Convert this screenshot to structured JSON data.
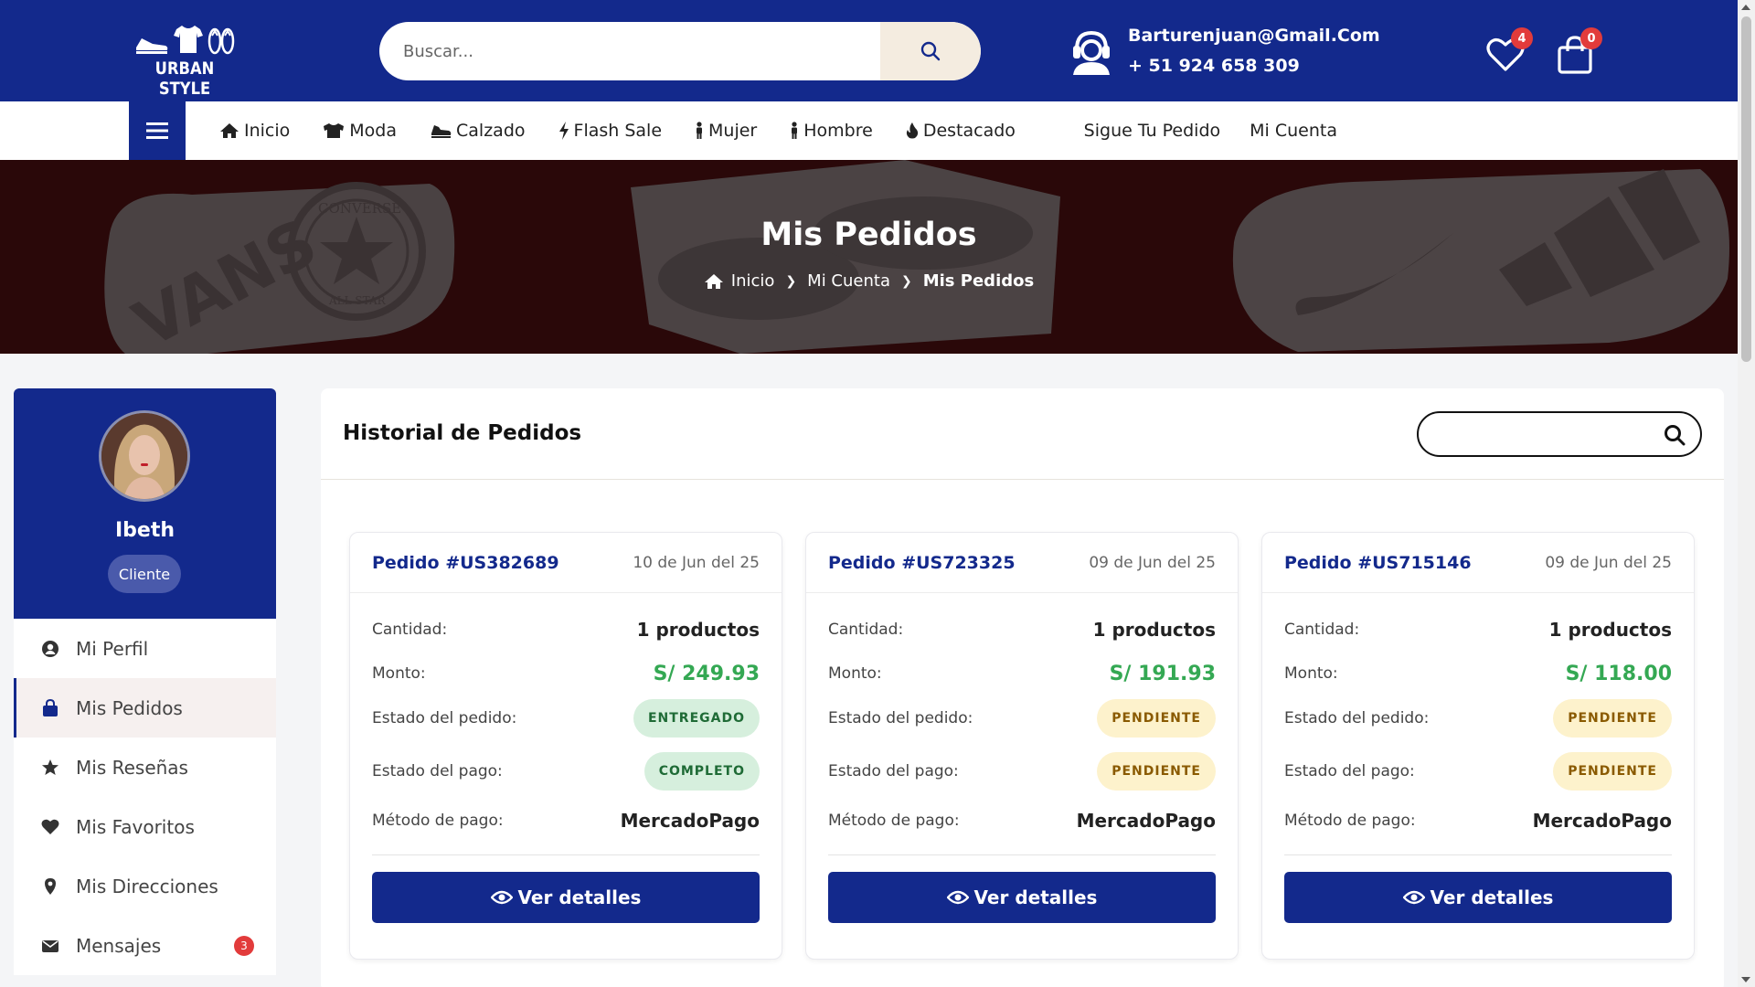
{
  "header": {
    "logo_text": "URBAN STYLE",
    "search_placeholder": "Buscar...",
    "email": "Barturenjuan@Gmail.Com",
    "phone": "+ 51 924 658 309",
    "wishlist_count": "4",
    "cart_count": "0"
  },
  "nav": {
    "items": [
      {
        "label": "Inicio",
        "icon": "home-icon"
      },
      {
        "label": "Moda",
        "icon": "tshirt-icon"
      },
      {
        "label": "Calzado",
        "icon": "shoe-icon"
      },
      {
        "label": "Flash Sale",
        "icon": "bolt-icon"
      },
      {
        "label": "Mujer",
        "icon": "person-icon"
      },
      {
        "label": "Hombre",
        "icon": "person-icon"
      },
      {
        "label": "Destacado",
        "icon": "fire-icon"
      }
    ],
    "right": [
      "Sigue Tu Pedido",
      "Mi Cuenta"
    ]
  },
  "hero": {
    "title": "Mis Pedidos",
    "breadcrumb": [
      "Inicio",
      "Mi Cuenta",
      "Mis Pedidos"
    ],
    "brand_art": [
      "VANS",
      "CONVERSE",
      "ALL STAR"
    ]
  },
  "profile": {
    "name": "Ibeth",
    "role": "Cliente"
  },
  "sidebar": {
    "items": [
      {
        "label": "Mi Perfil",
        "icon": "user-circle-icon",
        "active": false
      },
      {
        "label": "Mis Pedidos",
        "icon": "shopping-bag-icon",
        "active": true
      },
      {
        "label": "Mis Reseñas",
        "icon": "star-icon",
        "active": false
      },
      {
        "label": "Mis Favoritos",
        "icon": "heart-icon",
        "active": false
      },
      {
        "label": "Mis Direcciones",
        "icon": "map-pin-icon",
        "active": false
      },
      {
        "label": "Mensajes",
        "icon": "envelope-icon",
        "active": false,
        "badge": "3"
      }
    ]
  },
  "orders": {
    "title": "Historial de Pedidos",
    "labels": {
      "quantity": "Cantidad:",
      "amount": "Monto:",
      "order_status": "Estado del pedido:",
      "payment_status": "Estado del pago:",
      "payment_method": "Método de pago:",
      "details": "Ver detalles"
    },
    "list": [
      {
        "id": "Pedido #US382689",
        "date": "10 de Jun del 25",
        "quantity": "1 productos",
        "amount": "S/ 249.93",
        "order_status": "ENTREGADO",
        "payment_status": "COMPLETO",
        "method": "MercadoPago"
      },
      {
        "id": "Pedido #US723325",
        "date": "09 de Jun del 25",
        "quantity": "1 productos",
        "amount": "S/ 191.93",
        "order_status": "PENDIENTE",
        "payment_status": "PENDIENTE",
        "method": "MercadoPago"
      },
      {
        "id": "Pedido #US715146",
        "date": "09 de Jun del 25",
        "quantity": "1 productos",
        "amount": "S/ 118.00",
        "order_status": "PENDIENTE",
        "payment_status": "PENDIENTE",
        "method": "MercadoPago"
      }
    ]
  },
  "colors": {
    "brand": "#13298c",
    "money": "#34a853",
    "badge": "#e23b3b",
    "hero_bg": "#2a0809"
  }
}
